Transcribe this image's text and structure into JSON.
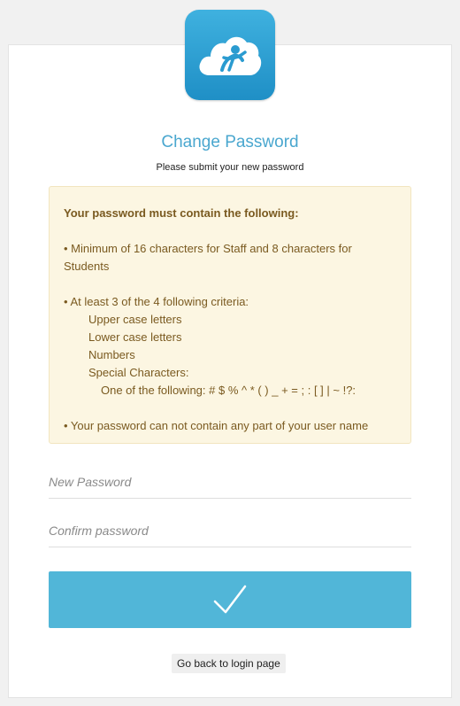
{
  "header": {
    "logo_icon": "cloud-person-logo-icon",
    "title": "Change Password",
    "subtitle": "Please submit your new password"
  },
  "requirements": {
    "heading": "Your password must contain the following:",
    "min_length": "• Minimum of 16 characters for Staff and 8 characters for Students",
    "criteria_intro": "• At least 3 of the 4 following criteria:",
    "criteria": [
      "Upper case letters",
      "Lower case letters",
      "Numbers",
      "Special Characters:"
    ],
    "special_chars": "One of the following: # $ % ^ * ( ) _ + = ; : [ ] | ~ !?:",
    "username_rule": "• Your password can not contain any part of your user name"
  },
  "form": {
    "new_password_placeholder": "New Password",
    "confirm_password_placeholder": "Confirm password",
    "submit_icon": "checkmark-icon"
  },
  "footer": {
    "back_label": "Go back to login page"
  },
  "colors": {
    "accent": "#51b6d8",
    "title": "#4aa7cf",
    "notice_bg": "#fcf6e2",
    "notice_text": "#7a5a20"
  }
}
